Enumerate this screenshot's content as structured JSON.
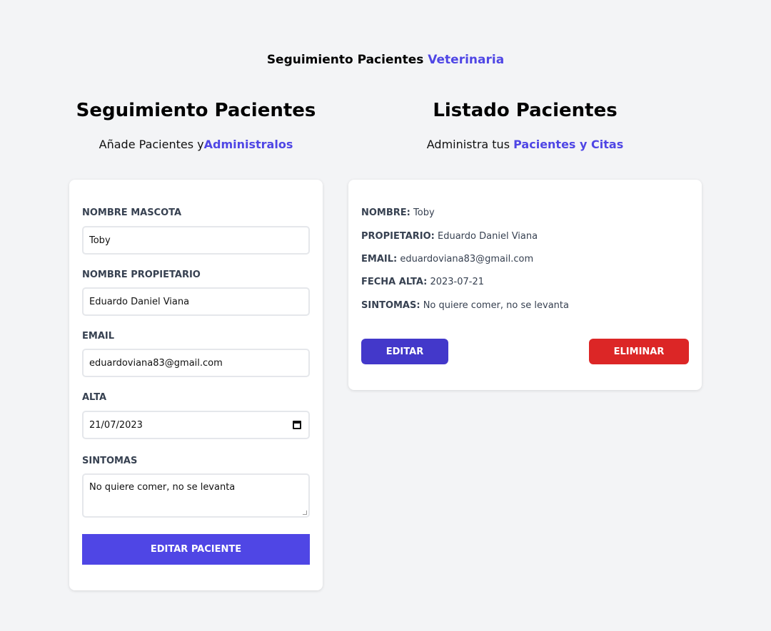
{
  "header": {
    "title_main": "Seguimiento Pacientes",
    "title_accent": "Veterinaria"
  },
  "form_section": {
    "heading": "Seguimiento Pacientes",
    "subtitle_prefix": "Añade Pacientes y",
    "subtitle_accent": "Administralos",
    "fields": {
      "mascota": {
        "label": "Nombre Mascota",
        "value": "Toby"
      },
      "propietario": {
        "label": "Nombre Propietario",
        "value": "Eduardo Daniel Viana"
      },
      "email": {
        "label": "Email",
        "value": "eduardoviana83@gmail.com"
      },
      "alta": {
        "label": "Alta",
        "value": "21/07/2023"
      },
      "sintomas": {
        "label": "Sintomas",
        "value": "No quiere comer, no se levanta"
      }
    },
    "submit_label": "Editar Paciente"
  },
  "list_section": {
    "heading": "Listado Pacientes",
    "subtitle_prefix": "Administra tus",
    "subtitle_accent": "Pacientes y Citas",
    "patient": {
      "nombre_label": "Nombre:",
      "nombre": "Toby",
      "propietario_label": "Propietario:",
      "propietario": "Eduardo Daniel Viana",
      "email_label": "Email:",
      "email": "eduardoviana83@gmail.com",
      "fecha_label": "Fecha Alta:",
      "fecha": "2023-07-21",
      "sintomas_label": "Sintomas:",
      "sintomas": "No quiere comer, no se levanta"
    },
    "edit_label": "Editar",
    "delete_label": "Eliminar"
  },
  "colors": {
    "accent": "#4f46e5",
    "edit": "#4338ca",
    "delete": "#dc2626",
    "background": "#f3f4f6"
  },
  "icons": {
    "date": "calendar-icon"
  }
}
